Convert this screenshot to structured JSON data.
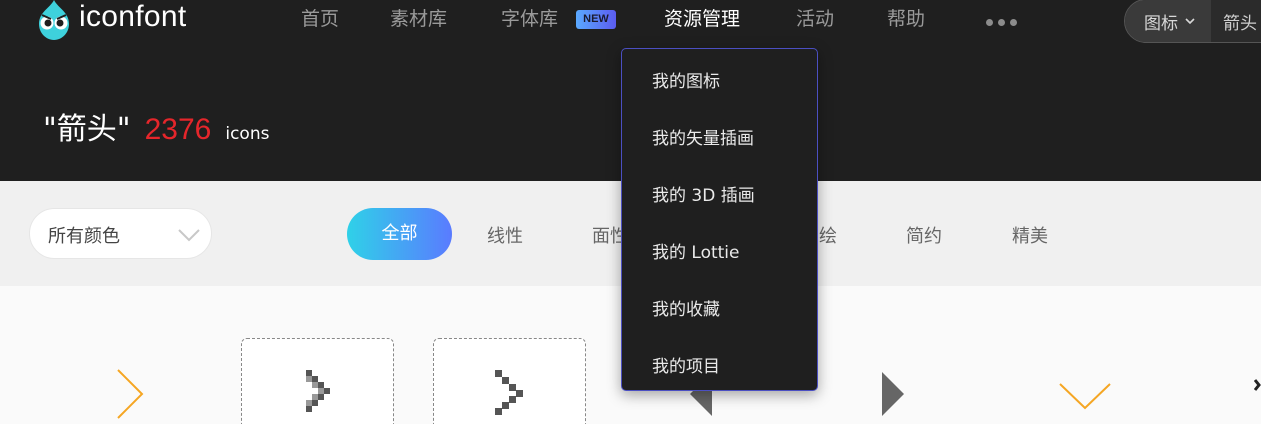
{
  "brand": {
    "name": "iconfont"
  },
  "nav": {
    "items": [
      {
        "label": "首页"
      },
      {
        "label": "素材库"
      },
      {
        "label": "字体库"
      },
      {
        "label": "资源管理"
      },
      {
        "label": "活动"
      },
      {
        "label": "帮助"
      }
    ],
    "new_badge": "NEW",
    "active": "资源管理"
  },
  "search": {
    "type_label": "图标",
    "value": "箭头"
  },
  "query": {
    "term": "\"箭头\"",
    "count": "2376",
    "unit": "icons"
  },
  "filter": {
    "color_select": "所有颜色",
    "styles": [
      "全部",
      "线性",
      "面性",
      "手绘",
      "简约",
      "精美"
    ],
    "visible_style_labels": {
      "all": "全部",
      "line": "线性",
      "face_partial": "面性",
      "hand_partial": "绘",
      "simple": "简约",
      "fine": "精美"
    },
    "active_style": "全部"
  },
  "dropdown": {
    "items": [
      "我的图标",
      "我的矢量插画",
      "我的 3D 插画",
      "我的 Lottie",
      "我的收藏",
      "我的项目"
    ]
  },
  "colors": {
    "header_bg": "#1f1f1f",
    "accent_red": "#e5262b",
    "gradient_start": "#2fd1e8",
    "gradient_end": "#5a7bff",
    "arrow_orange": "#f5a623"
  },
  "icons": [
    "chevron-right-orange-icon",
    "pixel-chevron-right-icon",
    "pixel-chevron-right-icon",
    "triangle-left-icon",
    "triangle-right-icon",
    "chevron-down-orange-icon"
  ]
}
